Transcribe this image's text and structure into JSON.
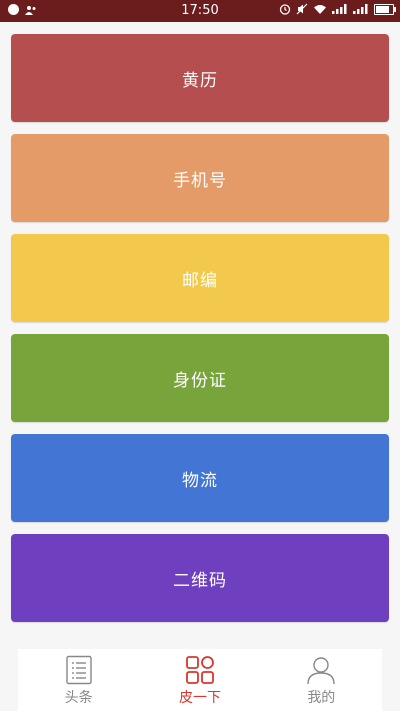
{
  "status_bar": {
    "time": "17:50"
  },
  "menu": {
    "items": [
      {
        "label": "黄历",
        "color": "#b54e4e"
      },
      {
        "label": "手机号",
        "color": "#e49b68"
      },
      {
        "label": "邮编",
        "color": "#f2c94c"
      },
      {
        "label": "身份证",
        "color": "#78a43c"
      },
      {
        "label": "物流",
        "color": "#4275d4"
      },
      {
        "label": "二维码",
        "color": "#6e40c0"
      }
    ]
  },
  "tab_bar": {
    "tabs": [
      {
        "label": "头条",
        "icon": "news-list-icon",
        "active": false
      },
      {
        "label": "皮一下",
        "icon": "grid-apps-icon",
        "active": true
      },
      {
        "label": "我的",
        "icon": "person-icon",
        "active": false
      }
    ],
    "active_color": "#d9372b",
    "inactive_color": "#888888"
  }
}
